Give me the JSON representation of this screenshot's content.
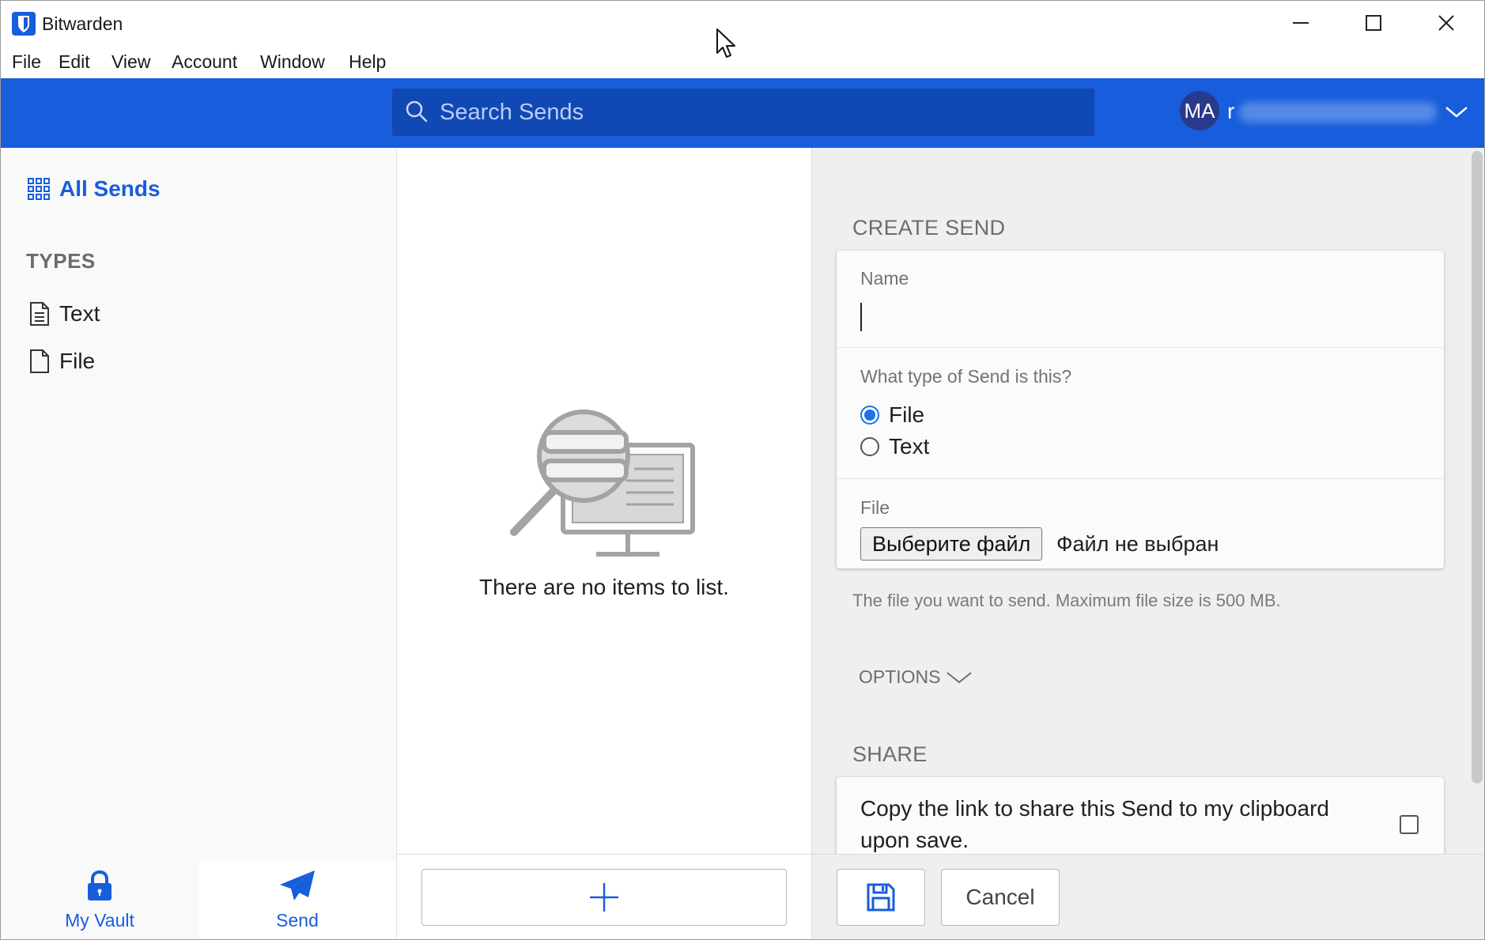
{
  "window": {
    "title": "Bitwarden",
    "controls": [
      "minimize",
      "maximize",
      "close"
    ]
  },
  "menu": [
    "File",
    "Edit",
    "View",
    "Account",
    "Window",
    "Help"
  ],
  "header": {
    "search_placeholder": "Search Sends",
    "avatar_initials": "MA",
    "account_name_visible": "r"
  },
  "sidebar": {
    "all_sends_label": "All Sends",
    "types_heading": "TYPES",
    "types": [
      {
        "label": "Text",
        "icon": "text-file-icon"
      },
      {
        "label": "File",
        "icon": "file-icon"
      }
    ],
    "nav": [
      {
        "label": "My Vault",
        "icon": "lock-icon",
        "active": false
      },
      {
        "label": "Send",
        "icon": "paper-plane-icon",
        "active": true
      }
    ]
  },
  "list": {
    "empty_message": "There are no items to list.",
    "add_icon": "plus-icon"
  },
  "details": {
    "create_title": "CREATE SEND",
    "name_label": "Name",
    "name_value": "",
    "type_question": "What type of Send is this?",
    "type_options": [
      {
        "label": "File",
        "checked": true
      },
      {
        "label": "Text",
        "checked": false
      }
    ],
    "file_label": "File",
    "file_button": "Выберите файл",
    "file_status": "Файл не выбран",
    "file_hint": "The file you want to send. Maximum file size is 500 MB.",
    "options_label": "OPTIONS",
    "share_title": "SHARE",
    "share_text": "Copy the link to share this Send to my clipboard upon save.",
    "share_checked": false,
    "save_icon": "save-icon",
    "cancel_label": "Cancel"
  },
  "colors": {
    "brand_blue": "#175ddc",
    "search_bg": "#1048b4"
  }
}
